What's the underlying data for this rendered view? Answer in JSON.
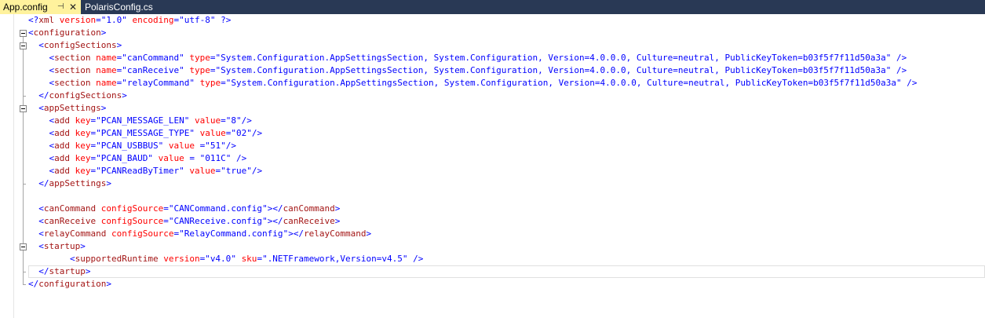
{
  "tabs": [
    {
      "label": "App.config",
      "active": true,
      "pin_icon": "pin-icon",
      "close_icon": "close-icon"
    },
    {
      "label": "PolarisConfig.cs",
      "active": false
    }
  ],
  "colors": {
    "tab_bar": "#293955",
    "active_tab": "#fff29d",
    "xml_delimiter": "#0000ff",
    "xml_element": "#a31515",
    "xml_attribute": "#ff0000",
    "xml_value": "#0000ff"
  },
  "code": {
    "lines": [
      "<?xml version=\"1.0\" encoding=\"utf-8\" ?>",
      "<configuration>",
      "  <configSections>",
      "    <section name=\"canCommand\" type=\"System.Configuration.AppSettingsSection, System.Configuration, Version=4.0.0.0, Culture=neutral, PublicKeyToken=b03f5f7f11d50a3a\" />",
      "    <section name=\"canReceive\" type=\"System.Configuration.AppSettingsSection, System.Configuration, Version=4.0.0.0, Culture=neutral, PublicKeyToken=b03f5f7f11d50a3a\" />",
      "    <section name=\"relayCommand\" type=\"System.Configuration.AppSettingsSection, System.Configuration, Version=4.0.0.0, Culture=neutral, PublicKeyToken=b03f5f7f11d50a3a\" />",
      "  </configSections>",
      "  <appSettings>",
      "    <add key=\"PCAN_MESSAGE_LEN\" value=\"8\"/>",
      "    <add key=\"PCAN_MESSAGE_TYPE\" value=\"02\"/>",
      "    <add key=\"PCAN_USBBUS\" value =\"51\"/>",
      "    <add key=\"PCAN_BAUD\" value = \"011C\" />",
      "    <add key=\"PCANReadByTimer\" value=\"true\"/>",
      "  </appSettings>",
      "",
      "  <canCommand configSource=\"CANCommand.config\"></canCommand>",
      "  <canReceive configSource=\"CANReceive.config\"></canReceive>",
      "  <relayCommand configSource=\"RelayCommand.config\"></relayCommand>",
      "  <startup>",
      "        <supportedRuntime version=\"v4.0\" sku=\".NETFramework,Version=v4.5\" />",
      "  </startup>",
      "</configuration>"
    ],
    "current_line": 20
  }
}
